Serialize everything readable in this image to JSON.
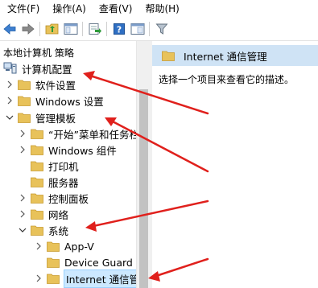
{
  "menu": {
    "file": "文件(F)",
    "action": "操作(A)",
    "view": "查看(V)",
    "help": "帮助(H)"
  },
  "toolbar": {
    "icons": [
      "back-arrow-icon",
      "forward-arrow-icon",
      "up-folder-icon",
      "show-hide-tree-icon",
      "export-list-icon",
      "help-icon",
      "properties-icon",
      "filter-icon"
    ]
  },
  "tree": {
    "header": "本地计算机 策略",
    "items": [
      {
        "label": "计算机配置"
      },
      {
        "label": "软件设置"
      },
      {
        "label": "Windows 设置"
      },
      {
        "label": "管理模板"
      },
      {
        "label": "“开始”菜单和任务栏"
      },
      {
        "label": "Windows 组件"
      },
      {
        "label": "打印机"
      },
      {
        "label": "服务器"
      },
      {
        "label": "控制面板"
      },
      {
        "label": "网络"
      },
      {
        "label": "系统"
      },
      {
        "label": "App-V"
      },
      {
        "label": "Device Guard"
      },
      {
        "label": "Internet 通信管"
      }
    ]
  },
  "right": {
    "title": "Internet 通信管理",
    "description": "选择一个项目来查看它的描述。"
  },
  "colors": {
    "folder": "#e8c25a",
    "selection": "#cce8ff",
    "header_bg": "#cfe3f5",
    "annotation_arrow": "#e0201c"
  }
}
